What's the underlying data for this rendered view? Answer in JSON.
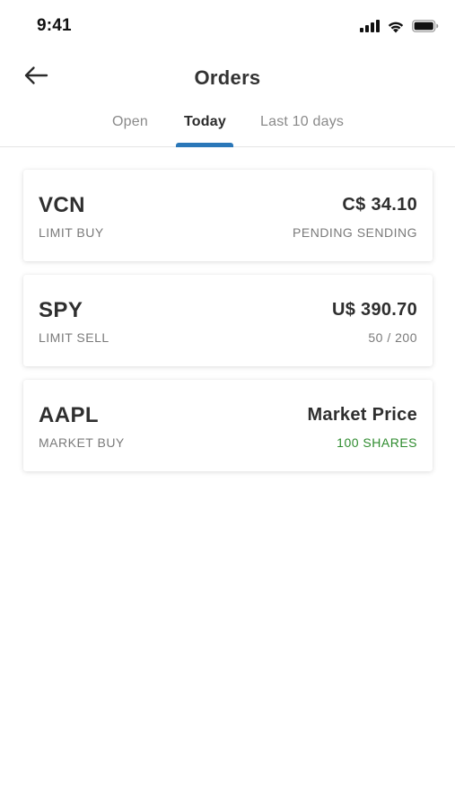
{
  "status_bar": {
    "time": "9:41",
    "icons": [
      "cellular-signal-icon",
      "wifi-icon",
      "battery-icon"
    ]
  },
  "header": {
    "back_icon": "arrow-left-icon",
    "title": "Orders"
  },
  "tabs": {
    "items": [
      {
        "label": "Open",
        "active": false
      },
      {
        "label": "Today",
        "active": true
      },
      {
        "label": "Last 10 days",
        "active": false
      }
    ],
    "indicator_color": "#2a77b8"
  },
  "orders": [
    {
      "symbol": "VCN",
      "type": "LIMIT BUY",
      "price": "C$ 34.10",
      "status": "PENDING SENDING",
      "status_color": "#7a7a7a"
    },
    {
      "symbol": "SPY",
      "type": "LIMIT SELL",
      "price": "U$ 390.70",
      "status": "50 / 200",
      "status_color": "#7a7a7a"
    },
    {
      "symbol": "AAPL",
      "type": "MARKET BUY",
      "price": "Market Price",
      "status": "100 SHARES",
      "status_color": "#2e8b2e"
    }
  ]
}
